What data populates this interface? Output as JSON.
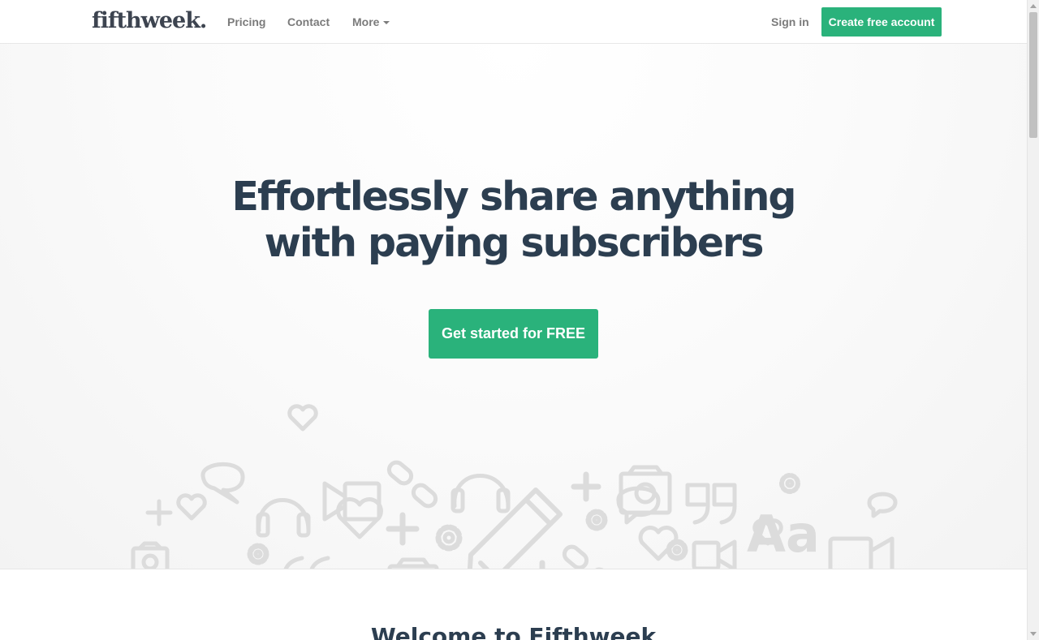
{
  "navbar": {
    "brand": "fifthweek.",
    "links": [
      "Pricing",
      "Contact",
      "More"
    ],
    "sign_in": "Sign in",
    "create_account": "Create free account"
  },
  "hero": {
    "headline_line1": "Effortlessly share anything",
    "headline_line2": "with paying subscribers",
    "cta": "Get started for FREE",
    "icon_art_text": "Aa"
  },
  "welcome": {
    "title": "Welcome to Fifthweek"
  },
  "colors": {
    "accent": "#2ab27b",
    "heading": "#2c3e50",
    "nav_text": "#7b7b7b",
    "icon_art": "#dcdcdc"
  },
  "icons": [
    "heart-icon",
    "chat-bubble-icon",
    "plus-icon",
    "camera-icon",
    "gear-icon",
    "headphones-icon",
    "link-icon",
    "pencil-icon",
    "quote-icon",
    "video-camera-icon",
    "book-icon",
    "text-aa-icon",
    "caret-down-icon"
  ]
}
